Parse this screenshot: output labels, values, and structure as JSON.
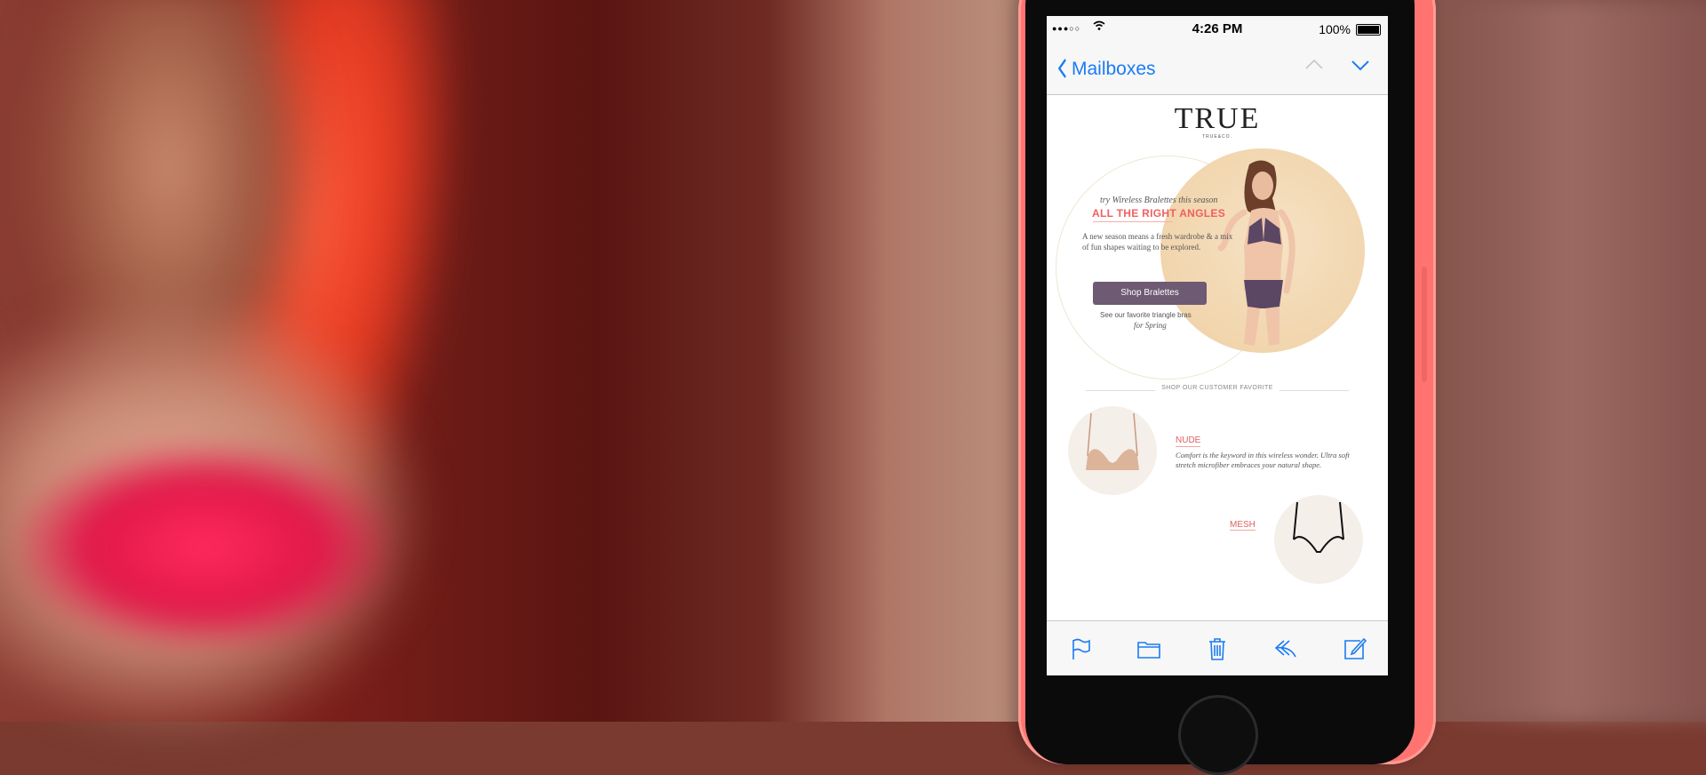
{
  "status_bar": {
    "signal": "●●●○○",
    "time": "4:26 PM",
    "battery_pct": "100%"
  },
  "nav": {
    "back_label": "Mailboxes"
  },
  "email": {
    "brand": "TRUE",
    "brand_sub": "TRUE&CO.",
    "hero": {
      "kicker": "try Wireless Bralettes this season",
      "headline": "ALL THE RIGHT ANGLES",
      "description": "A new season means a fresh wardrobe & a mix of fun shapes waiting to be explored.",
      "cta_label": "Shop Bralettes",
      "cta_note": "See our favorite triangle bras",
      "cta_note_italic": "for Spring"
    },
    "section_title": "SHOP OUR CUSTOMER FAVORITE",
    "products": [
      {
        "name": "NUDE",
        "description": "Comfort is the keyword in this wireless wonder. Ultra soft stretch microfiber embraces your natural shape."
      },
      {
        "name": "MESH"
      }
    ]
  },
  "toolbar": {
    "icons": [
      "flag-icon",
      "folder-icon",
      "trash-icon",
      "reply-icon",
      "compose-icon"
    ]
  },
  "colors": {
    "ios_blue": "#1a7cf4",
    "phone_body": "#ff7470",
    "accent_coral": "#f06060",
    "cta_purple": "#6e5a72"
  }
}
